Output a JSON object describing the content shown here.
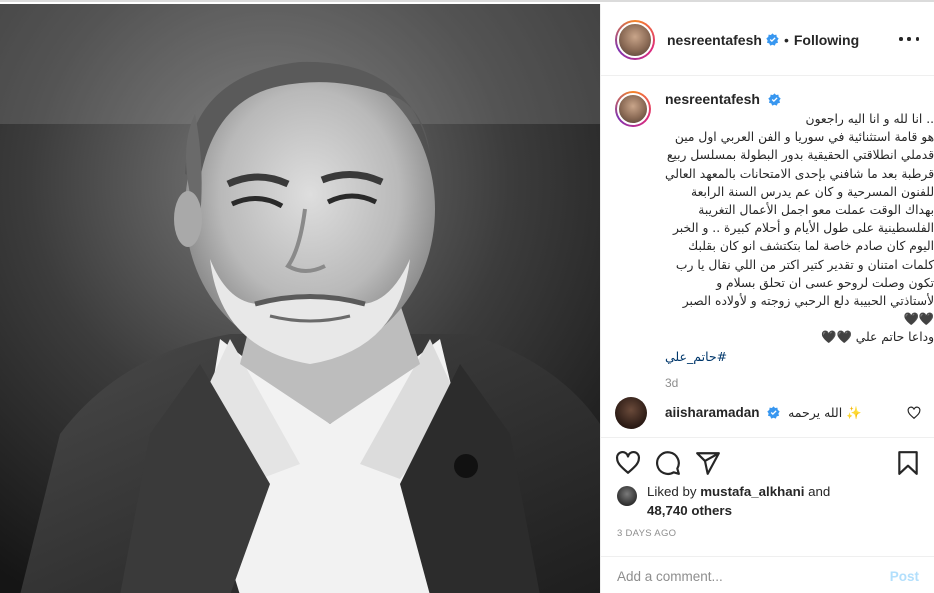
{
  "photo": {
    "alt_subject": "",
    "icon": "portrait-photo"
  },
  "header": {
    "username": "nesreentafesh",
    "verified": true,
    "separator": "•",
    "follow_label": "Following",
    "more_icon": "more-horizontal-icon"
  },
  "post": {
    "username": "nesreentafesh",
    "caption_lines": [
      ".. انا لله و انا اليه راجعون",
      "هو قامة استثنائية في سوريا و الفن العربي اول مين",
      "قدملي انطلاقتي الحقيقية بدور البطولة بمسلسل ربيع",
      "قرطبة بعد ما شافني بإحدى الامتحانات بالمعهد العالي",
      "للفنون المسرحية و كان عم يدرس السنة الرابعة",
      "بهداك الوقت عملت معو اجمل الأعمال التغريبة",
      "الفلسطينية على طول الأيام و أحلام كبيرة .. و الخبر",
      "اليوم كان صادم خاصة لما بتكتشف انو كان بقلبك",
      "كلمات امتنان و تقدير كتير اكتر من اللي نقال يا رب",
      "تكون وصلت لروحو عسى ان تحلق بسلام و",
      "لأستاذتي الحبيبة دلع الرحبي زوجته و لأولاده الصبر",
      "🖤🖤",
      "وداعا حاتم علي 🖤🖤"
    ],
    "hashtag": "#حاتم_علي",
    "time": "3d"
  },
  "comment": {
    "username": "aiisharamadan",
    "verified": true,
    "text": "الله يرحمه ✨",
    "like_icon": "heart-outline-icon"
  },
  "actions": {
    "like_icon": "heart-icon",
    "comment_icon": "comment-icon",
    "share_icon": "paper-plane-icon",
    "save_icon": "bookmark-icon"
  },
  "likes": {
    "prefix": "Liked by",
    "user": "mustafa_alkhani",
    "conj": "and",
    "others": "48,740 others"
  },
  "posted_ago": "3 DAYS AGO",
  "add_comment": {
    "placeholder": "Add a comment...",
    "post_label": "Post"
  },
  "colors": {
    "text": "#262626",
    "muted": "#8e8e8e",
    "verified": "#3897f0",
    "link": "#00376b",
    "post_disabled": "#b2dffc",
    "border": "#efefef"
  }
}
